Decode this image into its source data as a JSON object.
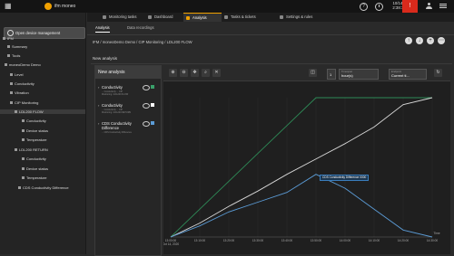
{
  "app": {
    "brand": "ifm moneo",
    "date": "10/14/2020",
    "time": "2:38:11 PM",
    "alert_symbol": "!",
    "accent": "#f0a000"
  },
  "sidebar": {
    "device_management": "Open device management",
    "items": [
      {
        "label": "IFM"
      },
      {
        "label": "Summary"
      },
      {
        "label": "Tools"
      },
      {
        "label": "moneoDemo Demo"
      },
      {
        "label": "Level"
      },
      {
        "label": "Conductivity"
      },
      {
        "label": "Vibration"
      },
      {
        "label": "CIP Monitoring"
      },
      {
        "label": "LDL200 FLOW"
      },
      {
        "label": "Conductivity"
      },
      {
        "label": "Device status"
      },
      {
        "label": "Temperature"
      },
      {
        "label": "LDL200 RETURN"
      },
      {
        "label": "Conductivity"
      },
      {
        "label": "Device status"
      },
      {
        "label": "Temperature"
      },
      {
        "label": "CDS Conductivity Difference"
      }
    ]
  },
  "tabs": [
    {
      "label": "Monitoring tasks"
    },
    {
      "label": "Dashboard"
    },
    {
      "label": "Analysis"
    },
    {
      "label": "Tasks & tickets"
    },
    {
      "label": "Settings & rules"
    }
  ],
  "subtabs": [
    {
      "label": "Analysis"
    },
    {
      "label": "Data recordings"
    }
  ],
  "breadcrumb": "IFM / moneoDemo Demo / CIP Monitoring / LDL200 FLOW",
  "section_label": "New analysis",
  "panel": {
    "title": "New analysis",
    "series": [
      {
        "name": "Conductivity",
        "sub1": "... Conductivity ... CIP",
        "sub2": "Monitoring / LDL200 FLOW",
        "color": "#3aa06a"
      },
      {
        "name": "Conductivity",
        "sub1": "... Conductivity ... CIP",
        "sub2": "Monitoring / LDL200 RETURN",
        "color": "#ffffff"
      },
      {
        "name": "CDS Conductivity",
        "name2": "Difference",
        "sub1": "... CDS Conductivity Difference",
        "sub2": "",
        "color": "#5b9bd5"
      }
    ]
  },
  "toolbar": {
    "timespan_label": "Timespan",
    "timespan_value": "hour(s)",
    "timespan_number": "1",
    "endpoint_label": "Endpoint",
    "endpoint_value": "Current ti...",
    "tooltip": "CDS Conductivity Difference 0000"
  },
  "chart_data": {
    "type": "line",
    "x": [
      "13:00:00",
      "13:10:00",
      "13:20:00",
      "13:30:00",
      "13:40:00",
      "13:50:00",
      "14:00:00",
      "14:10:00",
      "14:20:00",
      "14:30:00"
    ],
    "x_first_sub": "Oct 14, 2020",
    "x_end_label": "Time",
    "series": [
      {
        "color": "#2e8b57",
        "values": [
          0.0,
          0.2,
          0.4,
          0.6,
          0.8,
          1.0,
          1.0,
          1.0,
          1.0,
          1.0
        ]
      },
      {
        "color": "#d8d8d8",
        "values": [
          0.0,
          0.1,
          0.22,
          0.33,
          0.45,
          0.56,
          0.67,
          0.79,
          0.95,
          1.0
        ]
      },
      {
        "color": "#5b9bd5",
        "values": [
          0.0,
          0.08,
          0.18,
          0.25,
          0.32,
          0.45,
          0.35,
          0.2,
          0.05,
          0.0
        ]
      }
    ],
    "ylim": [
      0,
      1
    ],
    "grid": true,
    "legend": "none"
  }
}
